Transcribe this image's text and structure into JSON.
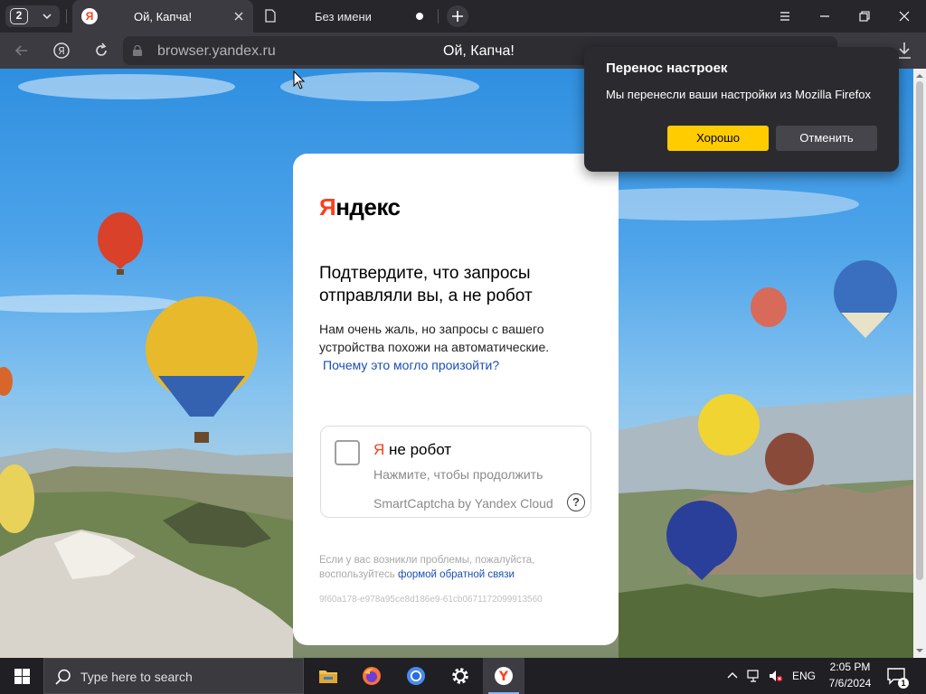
{
  "tabbar": {
    "tab_count": "2",
    "tabs": [
      {
        "title": "Ой, Капча!",
        "favicon": "Я",
        "active": true
      },
      {
        "title": "Без имени",
        "active": false
      }
    ]
  },
  "addressbar": {
    "url": "browser.yandex.ru",
    "page_title": "Ой, Капча!"
  },
  "captcha": {
    "logo_first": "Я",
    "logo_rest": "ндекс",
    "heading": "Подтвердите, что запросы отправляли вы, а не робот",
    "text": "Нам очень жаль, но запросы с вашего устройства похожи на автоматические.",
    "why_link": "Почему это могло произойти?",
    "checkbox_label_ya": "Я",
    "checkbox_label_rest": " не робот",
    "checkbox_hint": "Нажмите, чтобы продолжить",
    "provider": "SmartCaptcha by Yandex Cloud",
    "help_glyph": "?",
    "problems_text": "Если у вас возникли проблемы, пожалуйста, воспользуйтесь ",
    "feedback_link": "формой обратной связи",
    "request_id": "9f60a178-e978a95ce8d186e9-61cb0671172099913560"
  },
  "popup": {
    "title": "Перенос настроек",
    "text": "Мы перенесли ваши настройки из Mozilla Firefox",
    "ok_label": "Хорошо",
    "cancel_label": "Отменить"
  },
  "taskbar": {
    "search_placeholder": "Type here to search",
    "language": "ENG",
    "time": "2:05 PM",
    "date": "7/6/2024",
    "notification_count": "1",
    "apps": [
      "file-explorer",
      "firefox",
      "chromium",
      "settings",
      "yandex-browser"
    ]
  },
  "colors": {
    "accent_yellow": "#ffcc00",
    "yandex_red": "#fc3f1d",
    "link_blue": "#1a4fb3"
  }
}
